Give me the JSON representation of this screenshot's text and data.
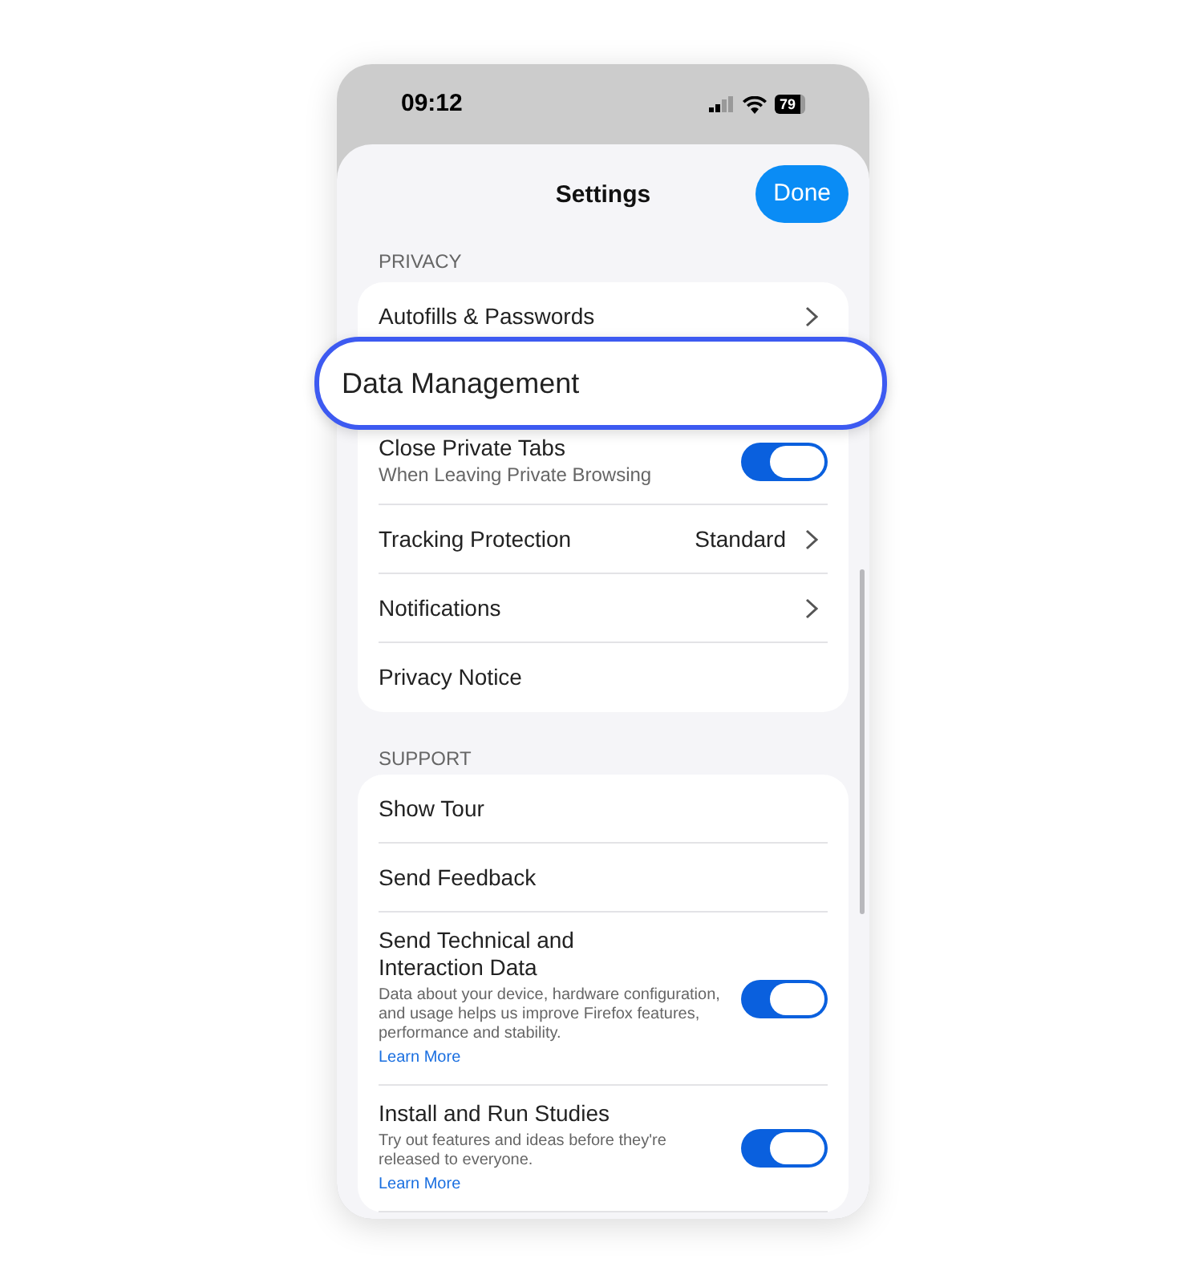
{
  "status_bar": {
    "time": "09:12",
    "battery": "79"
  },
  "header": {
    "title": "Settings",
    "done_button": "Done"
  },
  "sections": [
    {
      "title": "PRIVACY",
      "rows": [
        {
          "kind": "link",
          "label": "Autofills & Passwords"
        },
        {
          "kind": "covered"
        },
        {
          "kind": "toggle",
          "label": "Close Private Tabs",
          "subtitle": "When Leaving Private Browsing",
          "on": true
        },
        {
          "kind": "link",
          "label": "Tracking Protection",
          "value": "Standard"
        },
        {
          "kind": "link",
          "label": "Notifications"
        },
        {
          "kind": "plain",
          "label": "Privacy Notice"
        }
      ]
    },
    {
      "title": "SUPPORT",
      "rows": [
        {
          "kind": "plain",
          "label": "Show Tour"
        },
        {
          "kind": "plain",
          "label": "Send Feedback"
        },
        {
          "kind": "toggle",
          "label": "Send Technical and Interaction Data",
          "description": "Data about your device, hardware configuration, and usage helps us improve Firefox features, performance and stability.",
          "link": "Learn More",
          "on": true
        },
        {
          "kind": "toggle",
          "label": "Install and Run Studies",
          "description": "Try out features and ideas before they're released to everyone.",
          "link": "Learn More",
          "on": true
        }
      ]
    }
  ],
  "callout": {
    "label": "Data Management"
  }
}
